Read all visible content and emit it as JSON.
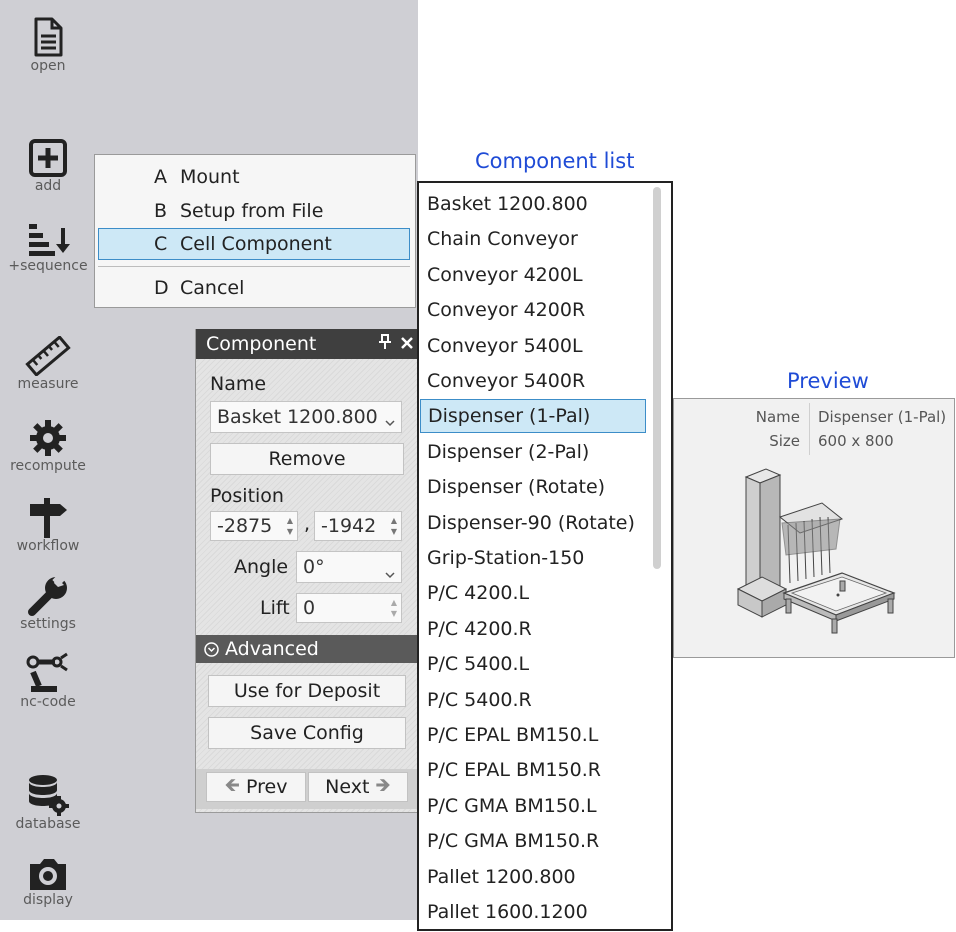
{
  "sidebar": {
    "tools": [
      {
        "label": "open",
        "icon": "file-icon"
      },
      {
        "label": "add",
        "icon": "plus-square-icon"
      },
      {
        "label": "+sequence",
        "icon": "sort-down-icon"
      },
      {
        "label": "measure",
        "icon": "ruler-icon"
      },
      {
        "label": "recompute",
        "icon": "gear-icon"
      },
      {
        "label": "workflow",
        "icon": "signpost-icon"
      },
      {
        "label": "settings",
        "icon": "wrench-icon"
      },
      {
        "label": "nc-code",
        "icon": "robot-arm-icon"
      },
      {
        "label": "database",
        "icon": "database-gear-icon"
      },
      {
        "label": "display",
        "icon": "camera-icon"
      }
    ]
  },
  "menu": {
    "items": [
      {
        "key": "A",
        "label": "Mount"
      },
      {
        "key": "B",
        "label": "Setup from File"
      },
      {
        "key": "C",
        "label": "Cell Component"
      },
      {
        "key": "D",
        "label": "Cancel"
      }
    ],
    "selected_index": 2
  },
  "component_panel": {
    "title": "Component",
    "pin_icon": "pin-icon",
    "close_icon": "close-icon",
    "name_label": "Name",
    "name_value": "Basket 1200.800",
    "remove_label": "Remove",
    "position_label": "Position",
    "position_x": "-2875",
    "position_sep": ",",
    "position_y": "-1942",
    "angle_label": "Angle",
    "angle_value": "0°",
    "lift_label": "Lift",
    "lift_value": "0",
    "advanced_label": "Advanced",
    "use_for_deposit_label": "Use for Deposit",
    "save_config_label": "Save Config",
    "prev_label": "Prev",
    "next_label": "Next"
  },
  "component_list": {
    "title": "Component list",
    "items": [
      "Basket 1200.800",
      "Chain Conveyor",
      "Conveyor 4200L",
      "Conveyor 4200R",
      "Conveyor 5400L",
      "Conveyor 5400R",
      "Dispenser (1-Pal)",
      "Dispenser (2-Pal)",
      "Dispenser (Rotate)",
      "Dispenser-90 (Rotate)",
      "Grip-Station-150",
      "P/C 4200.L",
      "P/C 4200.R",
      "P/C 5400.L",
      "P/C 5400.R",
      "P/C EPAL BM150.L",
      "P/C EPAL BM150.R",
      "P/C GMA BM150.L",
      "P/C GMA BM150.R",
      "Pallet 1200.800",
      "Pallet 1600.1200"
    ],
    "selected_index": 6
  },
  "preview": {
    "title": "Preview",
    "name_key": "Name",
    "name_value": "Dispenser (1-Pal)",
    "size_key": "Size",
    "size_value": "600 x 800"
  }
}
